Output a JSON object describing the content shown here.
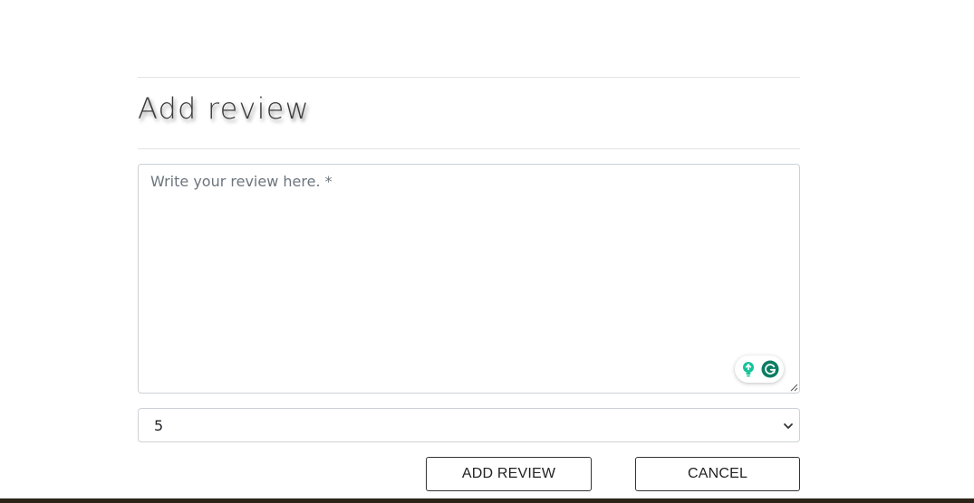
{
  "form": {
    "title": "Add review",
    "review_placeholder": "Write your review here. *",
    "review_value": "",
    "rating_selected": "5",
    "add_button_label": "ADD REVIEW",
    "cancel_button_label": "CANCEL"
  },
  "widgets": {
    "grammarly_icons": [
      "lightbulb-icon",
      "grammarly-g-icon"
    ],
    "grammarly_color": "#15c39a"
  },
  "colors": {
    "footer": "#2d2418",
    "text": "#212529",
    "border": "#cdd1d5"
  }
}
